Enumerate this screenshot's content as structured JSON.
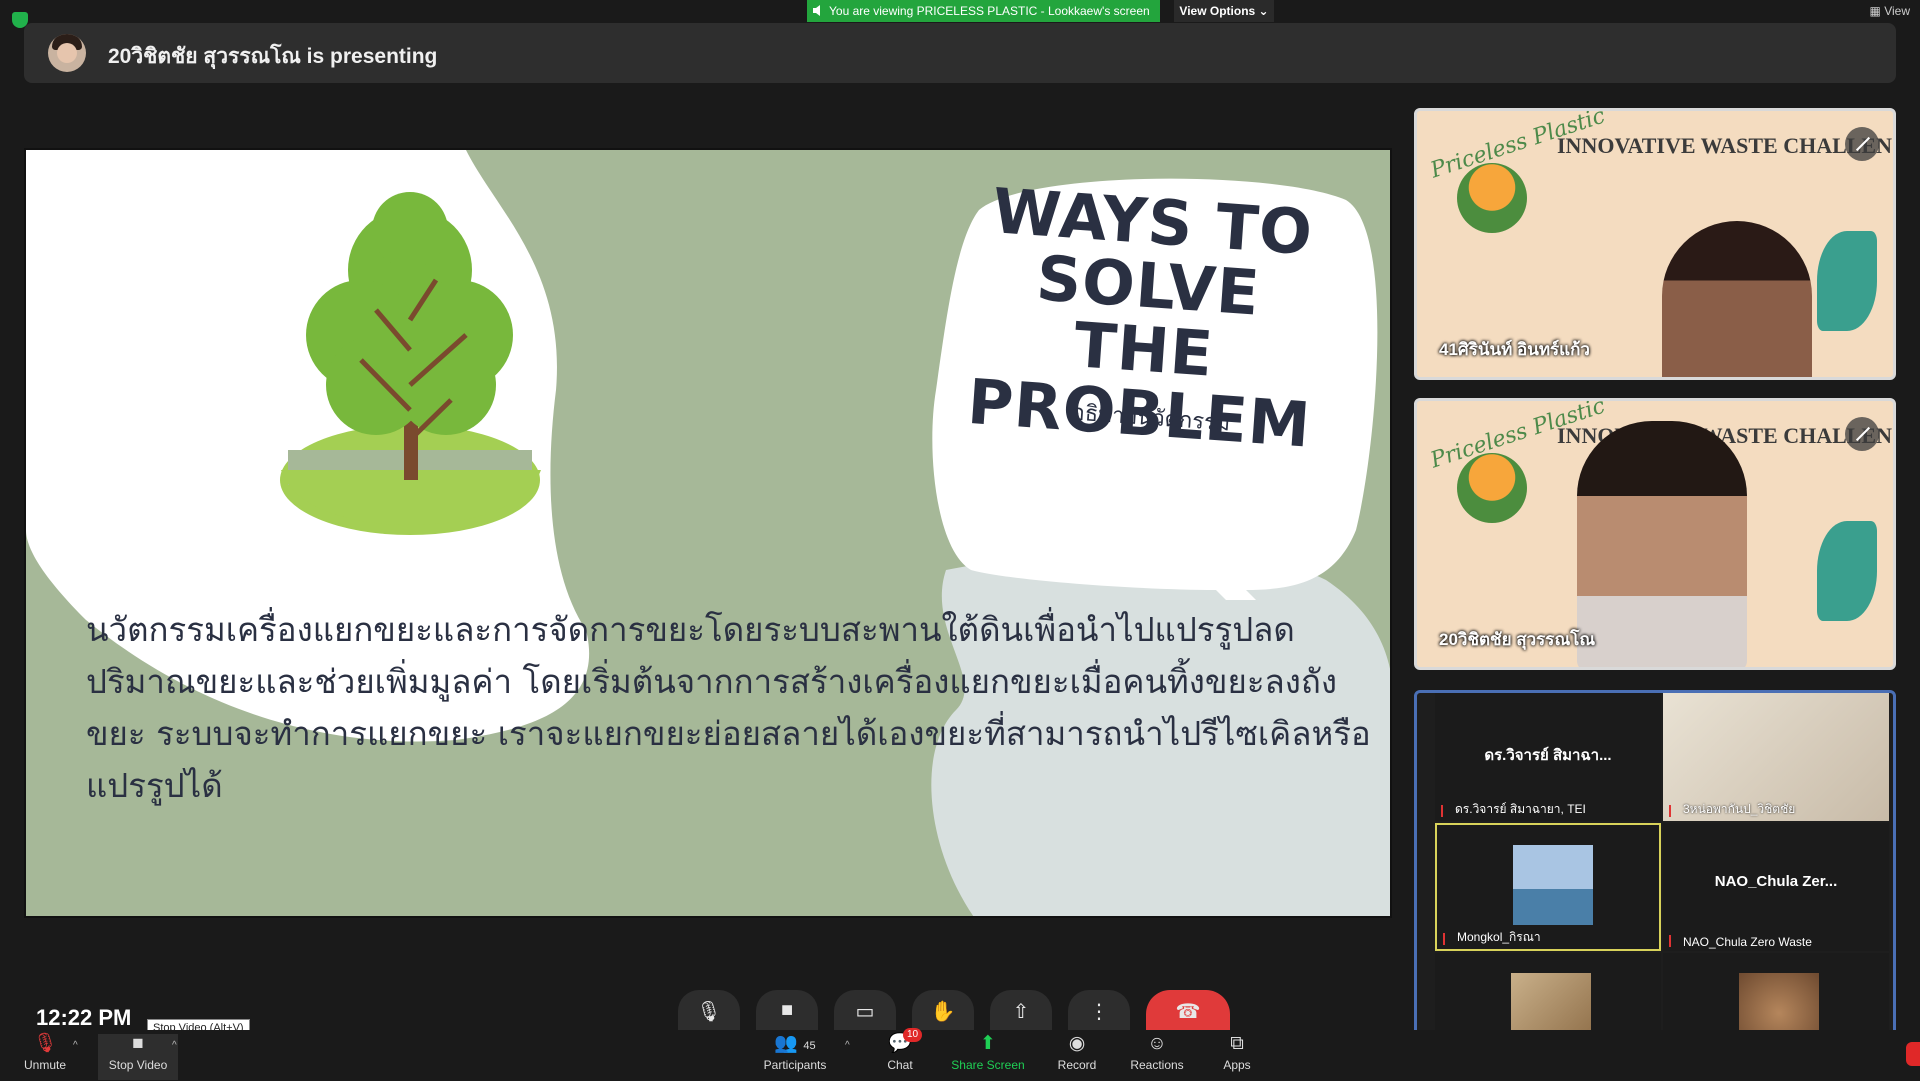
{
  "top": {
    "viewing_banner": "You are viewing PRICELESS PLASTIC - Lookkaew's screen",
    "view_options": "View Options",
    "view_button": "View"
  },
  "presenter_bar": {
    "text": "20วิชิตชัย สุวรรณโณ is presenting"
  },
  "slide": {
    "title": "WAYS TO SOLVE THE PROBLEM",
    "subtitle": "อธิบายนวัตกรรม",
    "body": "นวัตกรรมเครื่องแยกขยะและการจัดการขยะโดยระบบสะพานใต้ดินเพื่อนำไปแปรรูปลดปริมาณขยะและช่วยเพิ่มมูลค่า โดยเริ่มต้นจากการสร้างเครื่องแยกขยะเมื่อคนทิ้งขยะลงถังขยะ ระบบจะทำการแยกขยะ เราจะแยกขยะย่อยสลายได้เองขยะที่สามารถนำไปรีไซเคิลหรือแปรรูปได้"
  },
  "tiles": [
    {
      "brand": "Priceless Plastic",
      "banner": "INNOVATIVE WASTE CHALLENGE",
      "name": "41ศิรินันท์ อินทร์แก้ว"
    },
    {
      "brand": "Priceless Plastic",
      "banner": "INNOVATIVE WASTE CHALLENGE",
      "name": "20วิชิตชัย สุวรรณโณ"
    }
  ],
  "gallery": [
    {
      "name": "ดร.วิจารย์ สิมาฉา...",
      "label": "ดร.วิจารย์ สิมาฉายา, TEI"
    },
    {
      "name": "",
      "label": "3หน่อพากันป_วิชิตชัย"
    },
    {
      "name": "",
      "label": "Mongkol_กิรณา"
    },
    {
      "name": "NAO_Chula Zer...",
      "label": "NAO_Chula Zero Waste"
    },
    {
      "name": "",
      "label": ""
    },
    {
      "name": "",
      "label": ""
    }
  ],
  "time": "12:22 PM",
  "tooltip": "Stop Video (Alt+V)",
  "toolbar": {
    "unmute": "Unmute",
    "stop_video": "Stop Video",
    "participants": "Participants",
    "participants_count": "45",
    "chat": "Chat",
    "chat_badge": "10",
    "share_screen": "Share Screen",
    "record": "Record",
    "reactions": "Reactions",
    "apps": "Apps"
  },
  "icons": {
    "shield": "shield-icon",
    "speaker": "speaker-icon",
    "mic": "microphone-icon",
    "camera": "camera-icon",
    "participants": "participants-icon",
    "chat": "chat-icon",
    "share": "share-screen-icon",
    "record": "record-icon",
    "reactions": "reactions-icon",
    "apps": "apps-icon",
    "leave": "leave-phone-icon"
  },
  "colors": {
    "banner_green": "#23a53d",
    "slide_green": "#a6b898",
    "leave_red": "#e03a3a",
    "share_green": "#1fcf55",
    "gallery_border": "#4a6fb5"
  }
}
